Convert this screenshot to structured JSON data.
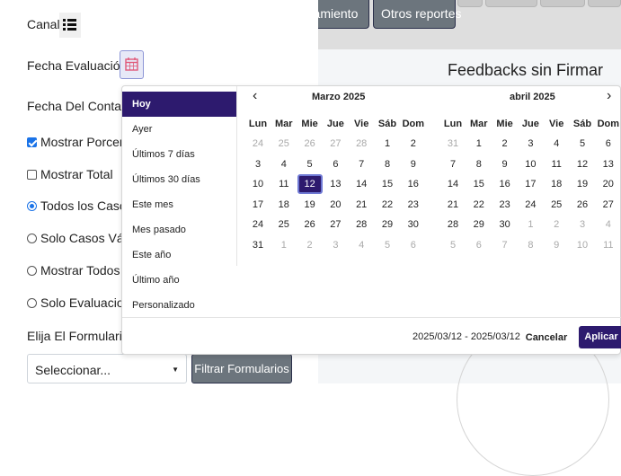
{
  "tabs": {
    "tab_partial": "rtamiento",
    "tab_reports": "Otros reportes"
  },
  "right": {
    "title": "Feedbacks sin Firmar"
  },
  "form": {
    "canal_label": "Canal",
    "fecha_eval_label": "Fecha Evaluación",
    "fecha_contacto_label": "Fecha Del Contact",
    "show_pct_label": "Mostrar Porcen",
    "show_total_label": "Mostrar Total",
    "all_cases_label": "Todos los Casos",
    "valid_cases_label": "Solo Casos Váli",
    "show_all_label": "Mostrar Todos",
    "only_evals_label": "Solo Evaluacior",
    "choose_form_label": "Elija El Formulario",
    "select_value": "Seleccionar...",
    "filter_button": "Filtrar Formularios"
  },
  "picker": {
    "ranges": [
      "Hoy",
      "Ayer",
      "Últimos 7 días",
      "Últimos 30 días",
      "Este mes",
      "Mes pasado",
      "Este año",
      "Último año",
      "Personalizado"
    ],
    "active_range": "Hoy",
    "weekdays": [
      "Lun",
      "Mar",
      "Mie",
      "Jue",
      "Vie",
      "Sáb",
      "Dom"
    ],
    "months": [
      {
        "title": "Marzo 2025",
        "weeks": [
          [
            "24",
            "25",
            "26",
            "27",
            "28",
            "1",
            "2"
          ],
          [
            "3",
            "4",
            "5",
            "6",
            "7",
            "8",
            "9"
          ],
          [
            "10",
            "11",
            "12",
            "13",
            "14",
            "15",
            "16"
          ],
          [
            "17",
            "18",
            "19",
            "20",
            "21",
            "22",
            "23"
          ],
          [
            "24",
            "25",
            "26",
            "27",
            "28",
            "29",
            "30"
          ],
          [
            "31",
            "1",
            "2",
            "3",
            "4",
            "5",
            "6"
          ]
        ]
      },
      {
        "title": "abril 2025",
        "weeks": [
          [
            "31",
            "1",
            "2",
            "3",
            "4",
            "5",
            "6"
          ],
          [
            "7",
            "8",
            "9",
            "10",
            "11",
            "12",
            "13"
          ],
          [
            "14",
            "15",
            "16",
            "17",
            "18",
            "19",
            "20"
          ],
          [
            "21",
            "22",
            "23",
            "24",
            "25",
            "26",
            "27"
          ],
          [
            "28",
            "29",
            "30",
            "1",
            "2",
            "3",
            "4"
          ],
          [
            "5",
            "6",
            "7",
            "8",
            "9",
            "10",
            "11"
          ]
        ]
      }
    ],
    "selected_range": "2025/03/12 - 2025/03/12",
    "cancel_label": "Cancelar",
    "apply_label": "Aplicar",
    "prev_icon": "‹",
    "next_icon": "›"
  },
  "colors": {
    "accent": "#2d1a6e",
    "button_gray": "#6c757d",
    "check_blue": "#1a73e8",
    "calendar_icon": "#e05a7a"
  }
}
